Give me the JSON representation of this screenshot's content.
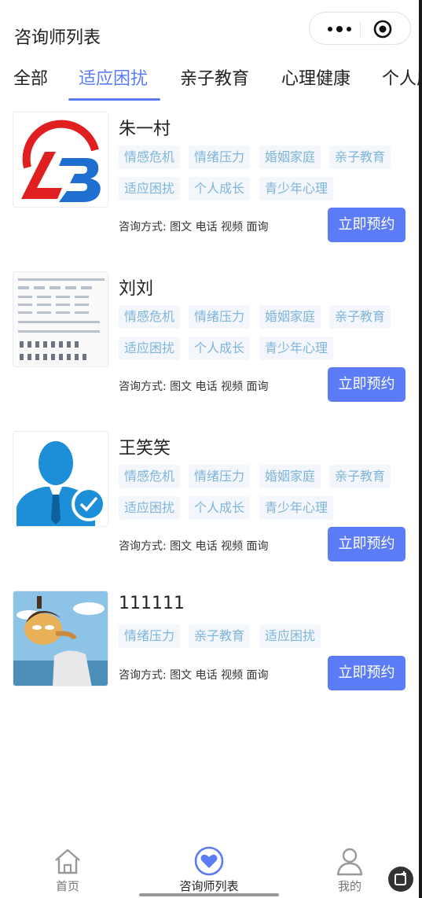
{
  "header": {
    "title": "咨询师列表"
  },
  "tabs": [
    {
      "label": "全部"
    },
    {
      "label": "适应困扰"
    },
    {
      "label": "亲子教育"
    },
    {
      "label": "心理健康"
    },
    {
      "label": "个人成长"
    }
  ],
  "active_tab": "适应困扰",
  "counselors": [
    {
      "name": "朱一村",
      "tags": [
        "情感危机",
        "情绪压力",
        "婚姻家庭",
        "亲子教育",
        "适应困扰",
        "个人成长",
        "青少年心理"
      ],
      "method_label": "咨询方式:",
      "methods": "图文 电话 视频 面询",
      "book_label": "立即预约"
    },
    {
      "name": "刘刘",
      "tags": [
        "情感危机",
        "情绪压力",
        "婚姻家庭",
        "亲子教育",
        "适应困扰",
        "个人成长",
        "青少年心理"
      ],
      "method_label": "咨询方式:",
      "methods": "图文 电话 视频 面询",
      "book_label": "立即预约"
    },
    {
      "name": "王笑笑",
      "tags": [
        "情感危机",
        "情绪压力",
        "婚姻家庭",
        "亲子教育",
        "适应困扰",
        "个人成长",
        "青少年心理"
      ],
      "method_label": "咨询方式:",
      "methods": "图文 电话 视频 面询",
      "book_label": "立即预约"
    },
    {
      "name": "111111",
      "tags": [
        "情绪压力",
        "亲子教育",
        "适应困扰"
      ],
      "method_label": "咨询方式:",
      "methods": "图文 电话 视频 面询",
      "book_label": "立即预约"
    }
  ],
  "tabbar": [
    {
      "label": "首页",
      "icon": "home-icon"
    },
    {
      "label": "咨询师列表",
      "icon": "heart-icon"
    },
    {
      "label": "我的",
      "icon": "user-icon"
    }
  ],
  "colors": {
    "accent": "#5b7cf6",
    "tag_text": "#7fb4d9",
    "tag_bg": "#f3f7fb"
  }
}
